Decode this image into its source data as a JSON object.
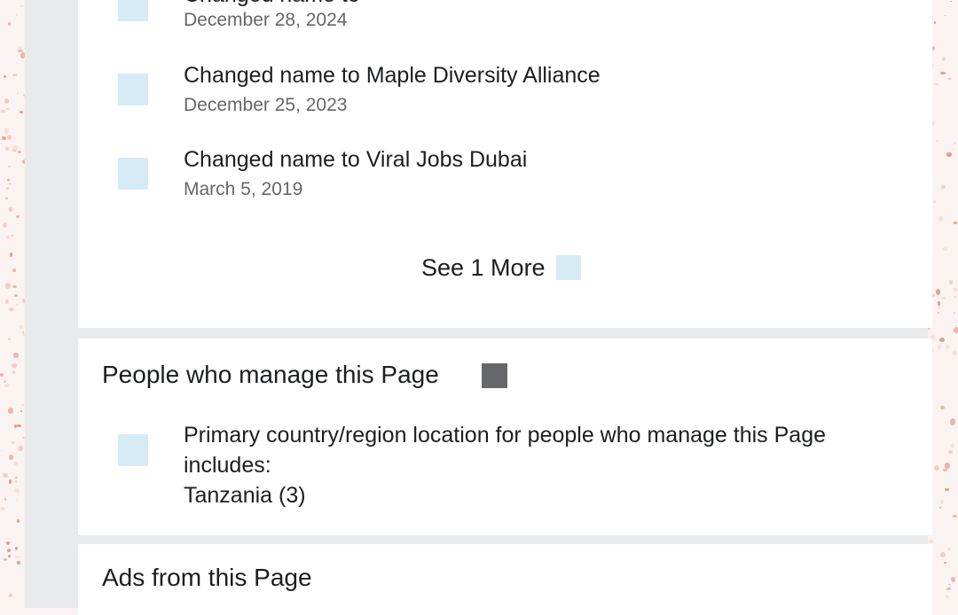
{
  "page_history": {
    "entries": [
      {
        "title": "Changed name to",
        "date": "December 28, 2024"
      },
      {
        "title": "Changed name to Maple Diversity Alliance",
        "date": "December 25, 2023"
      },
      {
        "title": "Changed name to Viral Jobs Dubai",
        "date": "March 5, 2019"
      }
    ],
    "see_more_label": "See 1 More",
    "see_more_icon": "chevron-down-icon"
  },
  "managers": {
    "title": "People who manage this Page",
    "info_icon": "info-icon",
    "location_icon": "location-icon",
    "description": "Primary country/region location for people who manage this Page includes:",
    "country": "Tanzania (3)"
  },
  "ads": {
    "title": "Ads from this Page"
  },
  "colors": {
    "icon_placeholder": "#d7ebf6",
    "info_icon": "#65676b",
    "divider": "#e9eaec",
    "primary_text": "#1c1e21",
    "secondary_text": "#65676b"
  }
}
